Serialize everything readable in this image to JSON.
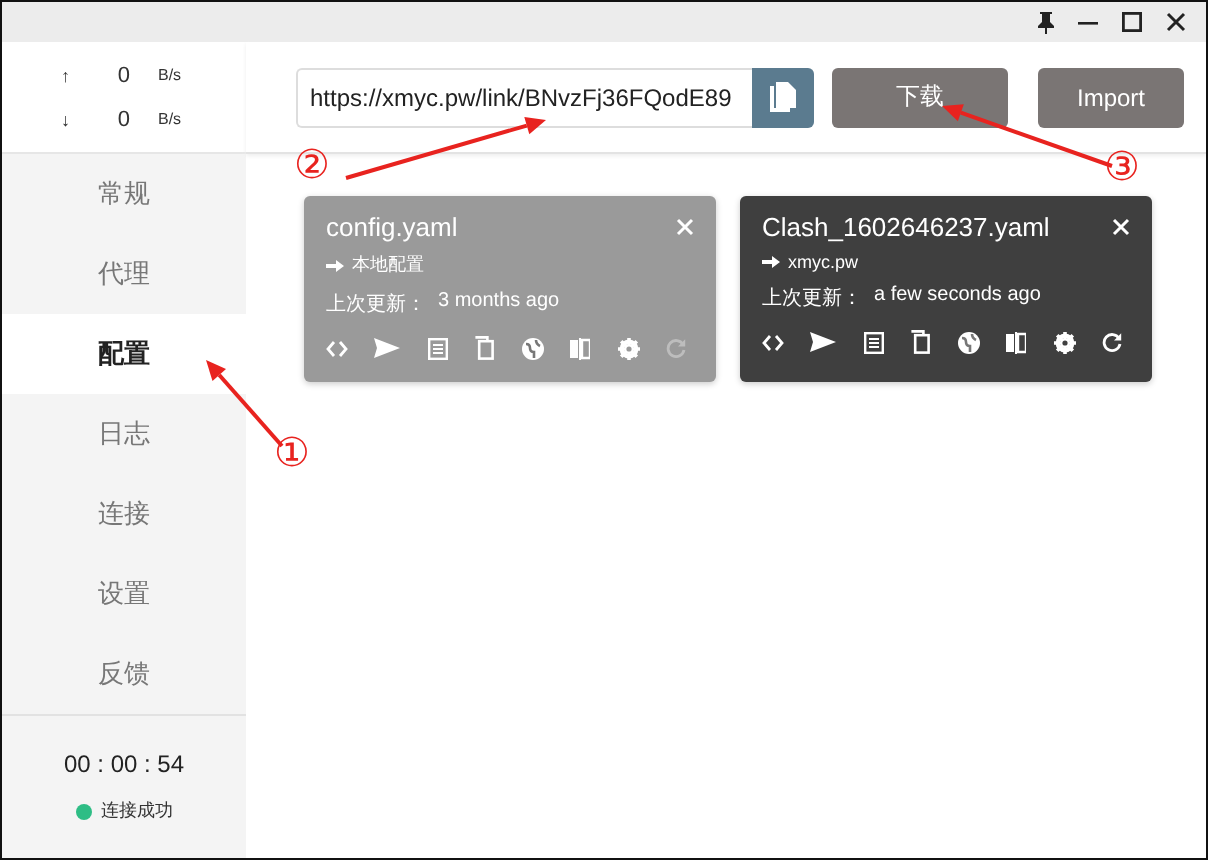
{
  "speed": [
    {
      "arrow": "↑",
      "value": "0",
      "unit": "B/s"
    },
    {
      "arrow": "↓",
      "value": "0",
      "unit": "B/s"
    }
  ],
  "sidebar": {
    "items": [
      {
        "label": "常规",
        "selected": false
      },
      {
        "label": "代理",
        "selected": false
      },
      {
        "label": "配置",
        "selected": true
      },
      {
        "label": "日志",
        "selected": false
      },
      {
        "label": "连接",
        "selected": false
      },
      {
        "label": "设置",
        "selected": false
      },
      {
        "label": "反馈",
        "selected": false
      }
    ]
  },
  "timer": "00 : 00 : 54",
  "status": "连接成功",
  "url_field": {
    "value": "https://xmyc.pw/link/BNvzFj36FQodE89"
  },
  "download_button": "下载",
  "import_button": "Import",
  "profiles": [
    {
      "name": "config.yaml",
      "source": "本地配置",
      "updated_label": "上次更新：",
      "updated": "3 months ago",
      "selected": false,
      "refreshable": false
    },
    {
      "name": "Clash_1602646237.yaml",
      "source": "xmyc.pw",
      "updated_label": "上次更新：",
      "updated": "a few seconds ago",
      "selected": true,
      "refreshable": true
    }
  ],
  "annotations": [
    {
      "label": "①"
    },
    {
      "label": "②"
    },
    {
      "label": "③"
    }
  ]
}
